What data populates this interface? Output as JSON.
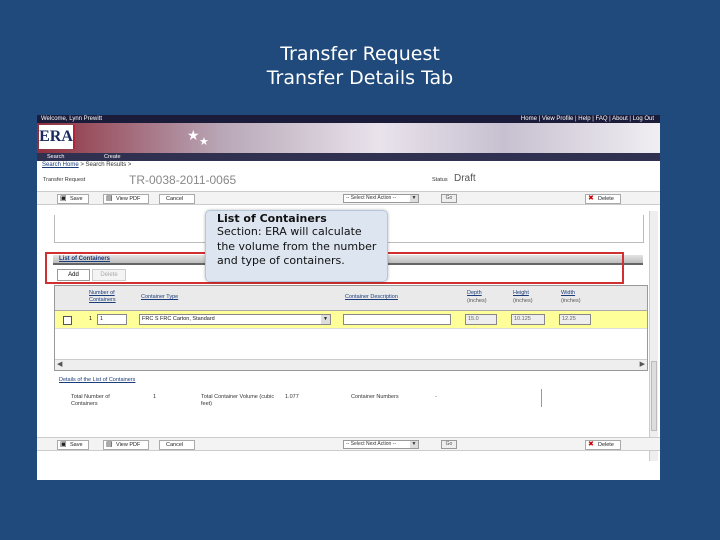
{
  "slide": {
    "title_line1": "Transfer Request",
    "title_line2": "Transfer Details Tab"
  },
  "app": {
    "topbar_user": "Welcome, Lynn Prewitt",
    "topbar_links": "Home | View Profile | Help | FAQ | About | Log Out",
    "logo": "ERA",
    "nav": [
      "Search",
      "Create"
    ],
    "breadcrumb_link": "Search Home",
    "breadcrumb_current": "> Search Results >",
    "request_label": "Transfer Request",
    "request_id": "TR-0038-2011-0065",
    "status_label": "Status",
    "status_value": "Draft"
  },
  "toolbar": {
    "save": "Save",
    "view_pdf": "View PDF",
    "cancel": "Cancel",
    "next_action": "-- Select Next Action --",
    "go": "Go",
    "delete": "Delete"
  },
  "containers": {
    "section_title": "List of Containers",
    "add_tab": "Add",
    "delete_tab": "Delete",
    "columns": {
      "num": "Number of Containers",
      "type": "Container Type",
      "desc": "Container Description",
      "depth": "Depth",
      "height": "Height",
      "width": "Width",
      "unit": "(inches)"
    },
    "row": {
      "prefix": "1",
      "num_value": "1",
      "type_value": "FRC S FRC Carton, Standard",
      "desc_value": "",
      "depth_value": "15.0",
      "height_value": "10.125",
      "width_value": "12.25"
    }
  },
  "details": {
    "title": "Details of the List of Containers",
    "total_num_label": "Total Number of Containers",
    "total_num_value": "1",
    "total_vol_label": "Total Container Volume (cubic feet)",
    "total_vol_value": "1.077",
    "numbers_label": "Container Numbers",
    "numbers_value": "-"
  },
  "callout": {
    "title": "List of Containers",
    "body": "Section: ERA will calculate the volume from the number and type of containers."
  },
  "colors": {
    "slide_bg": "#1f4a7b",
    "highlight": "#d03030",
    "row_highlight": "#ffff99"
  }
}
